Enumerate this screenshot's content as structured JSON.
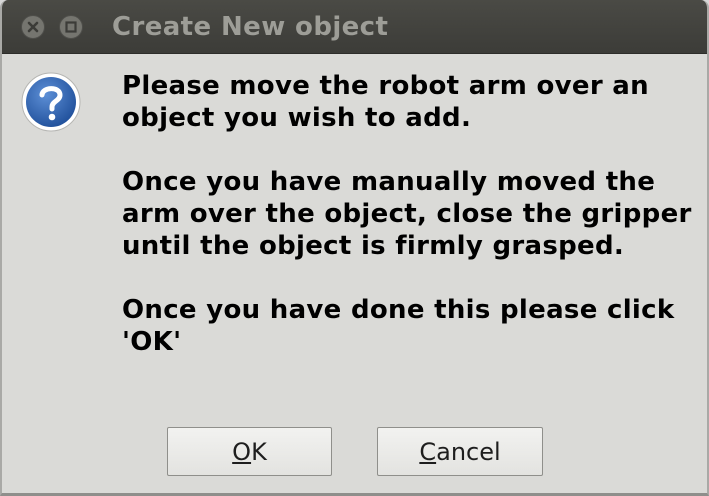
{
  "window": {
    "title": "Create New object"
  },
  "message": {
    "paragraphs": [
      "Please move the robot arm over an object you wish to add.",
      "Once you have manually moved the arm over the object, close the gripper until the object is firmly grasped.",
      "Once you have done this please click 'OK'"
    ]
  },
  "buttons": {
    "ok": {
      "mnemonic": "O",
      "rest": "K"
    },
    "cancel": {
      "mnemonic": "C",
      "rest": "ancel"
    }
  },
  "icons": {
    "close": "close-icon",
    "minimize": "minimize-icon",
    "dialog": "question-icon"
  },
  "colors": {
    "titlebar": "#3f3f3b",
    "title_text": "#9d9d97",
    "dialog_bg": "#dadad7",
    "icon_blue": "#2d5fab"
  }
}
